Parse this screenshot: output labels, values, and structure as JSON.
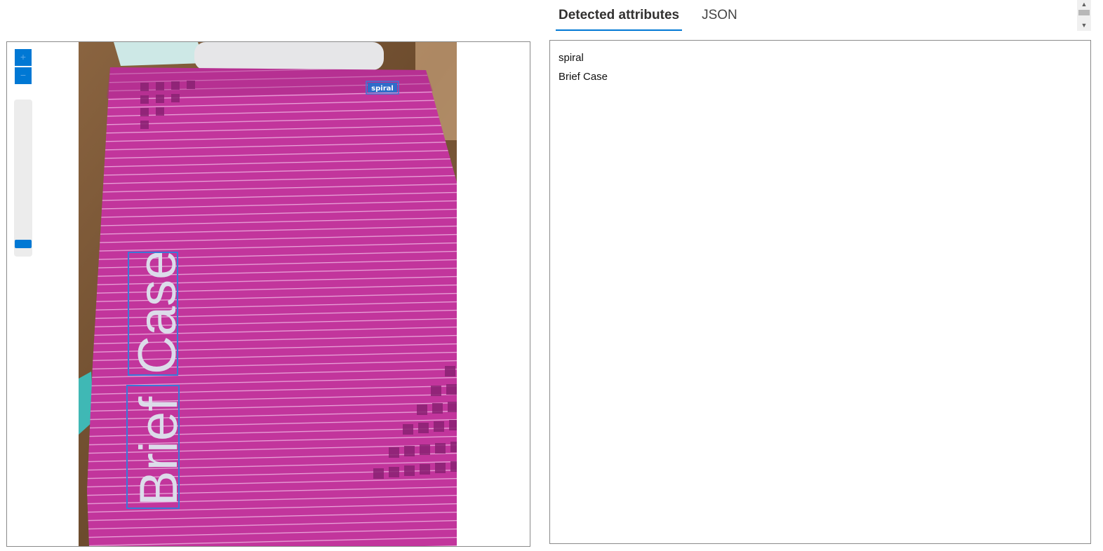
{
  "tabs": [
    {
      "label": "Detected attributes",
      "active": true
    },
    {
      "label": "JSON",
      "active": false
    }
  ],
  "zoom": {
    "in_label": "+",
    "out_label": "−",
    "level": 0
  },
  "image": {
    "brand_label": "spiral",
    "cover_words": [
      "Brief",
      "Case"
    ],
    "cover_color": "#c2359c",
    "box_color": "#3a78d8"
  },
  "attributes": [
    "spiral",
    "Brief Case"
  ],
  "colors": {
    "accent": "#0078d4",
    "border": "#8a8a8a"
  }
}
